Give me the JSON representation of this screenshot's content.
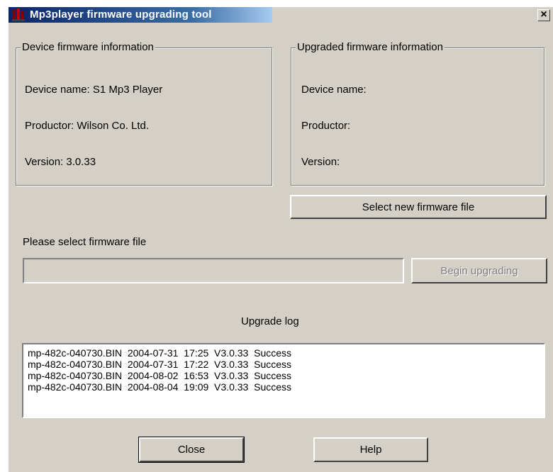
{
  "window": {
    "title": "Mp3player firmware upgrading tool",
    "close_glyph": "×"
  },
  "device_group": {
    "legend": "Device firmware information",
    "device_name": "Device name: S1 Mp3 Player",
    "productor": "Productor: Wilson Co. Ltd.",
    "version": "Version: 3.0.33"
  },
  "upgraded_group": {
    "legend": "Upgraded firmware information",
    "device_name": "Device name:",
    "productor": "Productor:",
    "version": "Version:"
  },
  "select_button_label": "Select new firmware file",
  "firmware_prompt": "Please select firmware file",
  "firmware_path_value": "",
  "begin_button_label": "Begin upgrading",
  "upgrade_log": {
    "heading": "Upgrade log",
    "entries": [
      "mp-482c-040730.BIN  2004-07-31  17:25  V3.0.33  Success",
      "mp-482c-040730.BIN  2004-07-31  17:22  V3.0.33  Success",
      "mp-482c-040730.BIN  2004-08-02  16:53  V3.0.33  Success",
      "mp-482c-040730.BIN  2004-08-04  19:09  V3.0.33  Success"
    ]
  },
  "close_button_label": "Close",
  "help_button_label": "Help",
  "colors": {
    "dialog_face": "#d4d0c8",
    "title_active": "#0a246a"
  },
  "icons": [
    "app-icon",
    "close-icon"
  ]
}
